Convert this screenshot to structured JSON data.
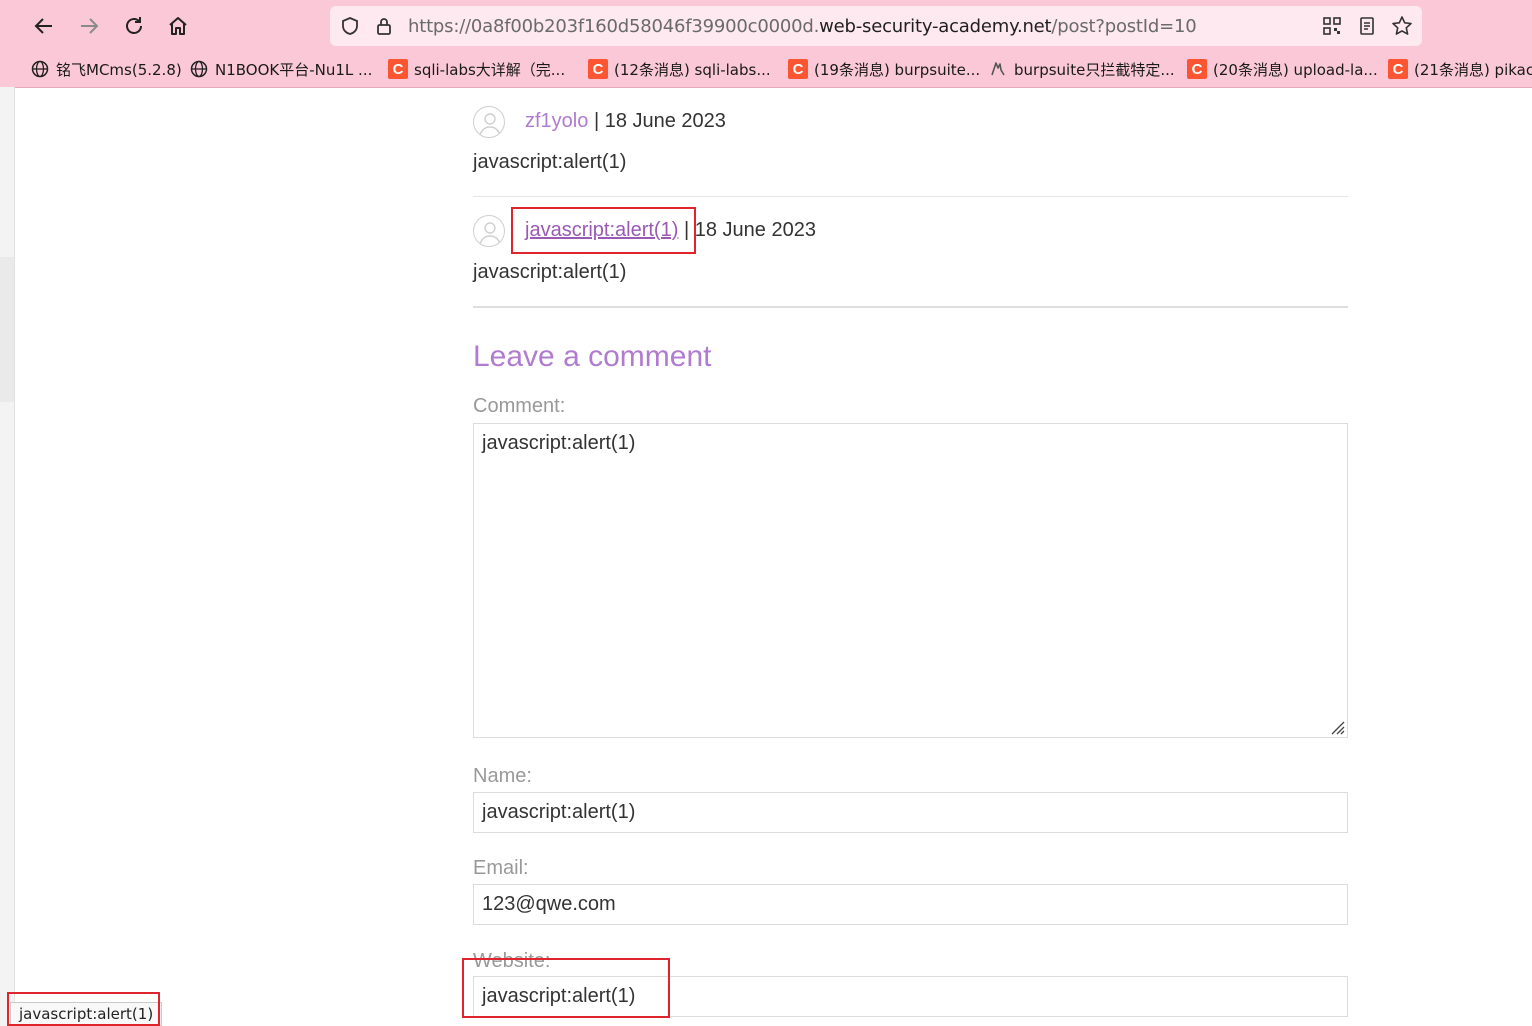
{
  "browser": {
    "url_prefix": "https://0a8f00b203f160d58046f39900c0000d.",
    "url_domain": "web-security-academy.net",
    "url_path": "/post?postId=10",
    "bookmarks": [
      {
        "label": "铭飞MCms(5.2.8)",
        "icon": "globe-icon"
      },
      {
        "label": "N1BOOK平台-Nu1L ...",
        "icon": "globe-icon"
      },
      {
        "label": "sqli-labs大详解（完...",
        "icon": "csdn-icon"
      },
      {
        "label": "(12条消息) sqli-labs...",
        "icon": "csdn-icon"
      },
      {
        "label": "(19条消息) burpsuite...",
        "icon": "csdn-icon"
      },
      {
        "label": "burpsuite只拦截特定...",
        "icon": "wolf-icon"
      },
      {
        "label": "(20条消息) upload-la...",
        "icon": "csdn-icon"
      },
      {
        "label": "(21条消息) pikac",
        "icon": "csdn-icon"
      }
    ]
  },
  "comments": [
    {
      "author": "zf1yolo",
      "separator": "|",
      "date": "18 June 2023",
      "text": "javascript:alert(1)"
    },
    {
      "author": "javascript:alert(1)",
      "separator": "|",
      "date": "18 June 2023",
      "text": "javascript:alert(1)"
    }
  ],
  "form": {
    "title": "Leave a comment",
    "comment_label": "Comment:",
    "comment_value": "javascript:alert(1)",
    "name_label": "Name:",
    "name_value": "javascript:alert(1)",
    "email_label": "Email:",
    "email_value": "123@qwe.com",
    "website_label": "Website:",
    "website_value": "javascript:alert(1)"
  },
  "status_bar": {
    "link_preview": "javascript:alert(1)"
  },
  "colors": {
    "toolbar": "#fbc8d8",
    "accent": "#b07bd0",
    "highlight": "#e0242c"
  }
}
